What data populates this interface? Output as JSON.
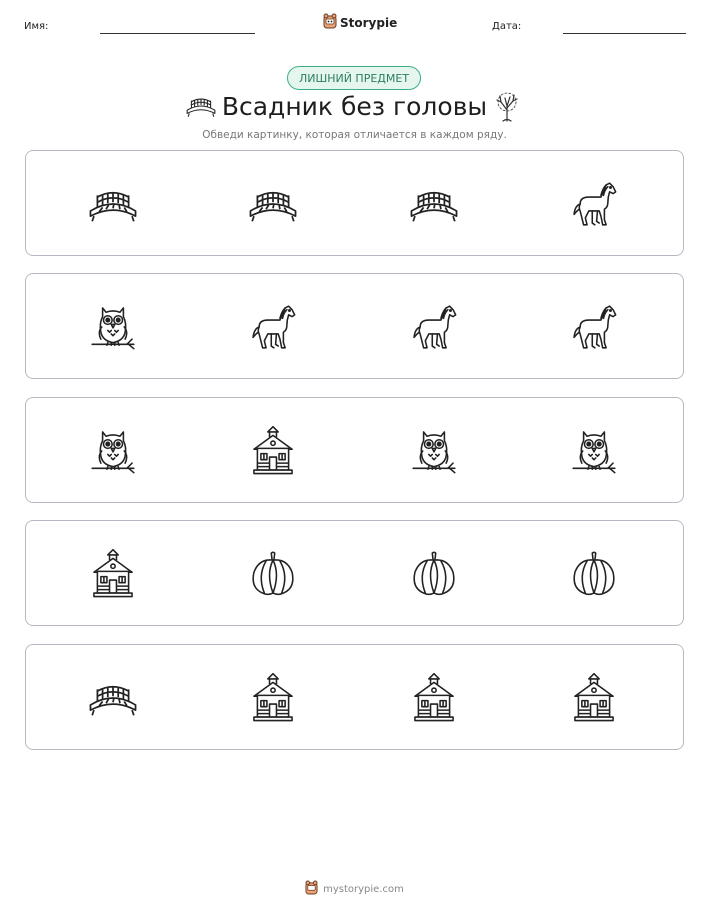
{
  "header": {
    "name_label": "Имя:",
    "date_label": "Дата:",
    "brand": "Storypie"
  },
  "badge": "ЛИШНИЙ ПРЕДМЕТ",
  "title": "Всадник без головы",
  "instruction": "Обведи картинку, которая отличается в каждом ряду.",
  "rows": [
    [
      "bridge-icon",
      "bridge-icon",
      "bridge-icon",
      "horse-icon"
    ],
    [
      "owl-icon",
      "horse-icon",
      "horse-icon",
      "horse-icon"
    ],
    [
      "owl-icon",
      "schoolhouse-icon",
      "owl-icon",
      "owl-icon"
    ],
    [
      "schoolhouse-icon",
      "pumpkin-icon",
      "pumpkin-icon",
      "pumpkin-icon"
    ],
    [
      "bridge-icon",
      "schoolhouse-icon",
      "schoolhouse-icon",
      "schoolhouse-icon"
    ]
  ],
  "footer": "mystorypie.com",
  "colors": {
    "badge_border": "#3cae85",
    "badge_fill": "#e4f6ee",
    "row_border": "#b9b9c4"
  }
}
